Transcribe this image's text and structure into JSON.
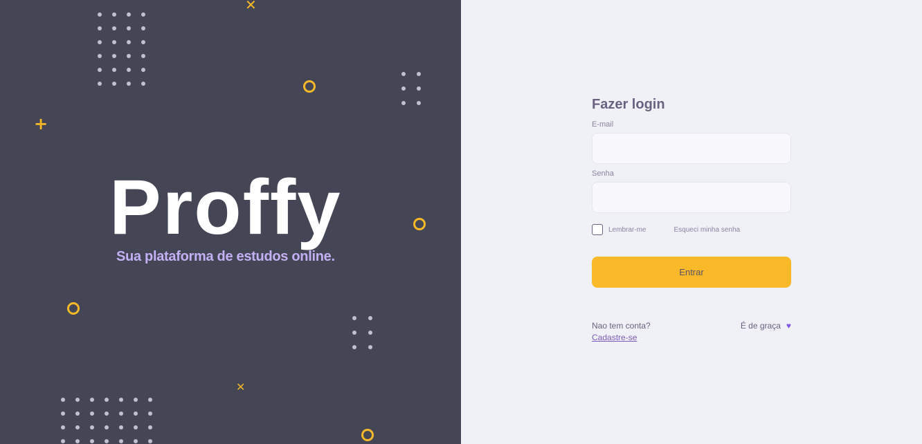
{
  "brand": {
    "logo_text": "Proffy",
    "tagline": "Sua plataforma de estudos online."
  },
  "login": {
    "title": "Fazer login",
    "email_label": "E-mail",
    "email_value": "",
    "password_label": "Senha",
    "password_value": "",
    "remember_label": "Lembrar-me",
    "remember_checked": false,
    "forgot_label": "Esqueci minha senha",
    "submit_label": "Entrar"
  },
  "footer": {
    "no_account": "Nao tem conta?",
    "signup_link": "Cadastre-se",
    "free_text": "É de graça",
    "heart_icon": "heart-icon"
  },
  "colors": {
    "left_bg": "#444656",
    "right_bg": "#f0f0f7",
    "accent_yellow": "#f9b928",
    "accent_purple": "#8257e5",
    "tagline_color": "#c4b0f5"
  }
}
